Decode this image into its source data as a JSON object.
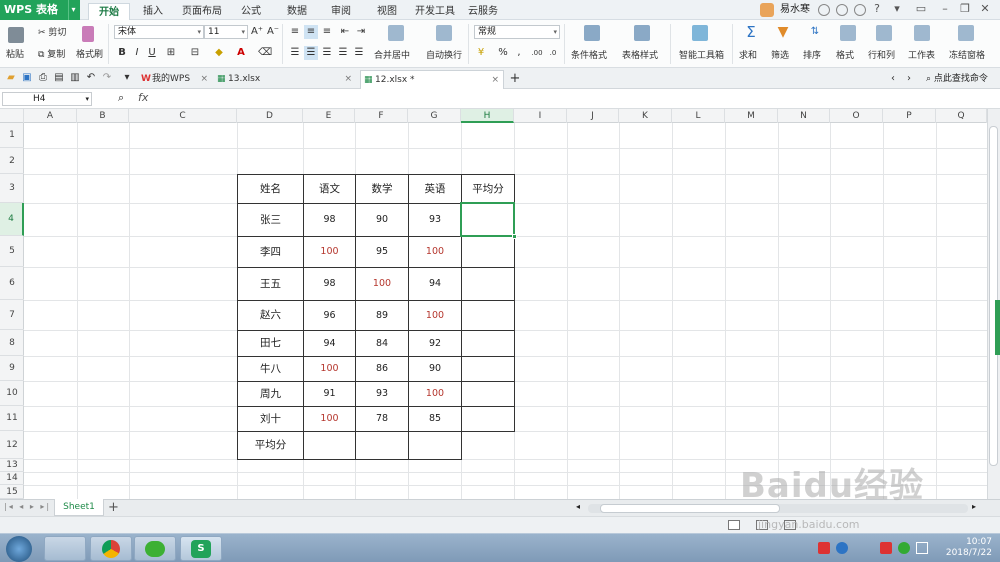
{
  "app": {
    "title": "WPS 表格",
    "brand_color": "#22a35a"
  },
  "menu": {
    "tabs": [
      "开始",
      "插入",
      "页面布局",
      "公式",
      "数据",
      "审阅",
      "视图",
      "开发工具",
      "云服务"
    ],
    "active": "开始",
    "user": "易水寒"
  },
  "ribbon": {
    "paste": "粘贴",
    "cut": "剪切",
    "copy": "复制",
    "format_painter": "格式刷",
    "font_name": "宋体",
    "font_size": "11",
    "number_format": "常规",
    "merge_center": "合并居中",
    "wrap_text": "自动换行",
    "conditional_format": "条件格式",
    "table_style": "表格样式",
    "smart_toolbox": "智能工具箱",
    "sum": "求和",
    "filter": "筛选",
    "sort": "排序",
    "format": "格式",
    "row_col": "行和列",
    "worksheet": "工作表",
    "freeze": "冻结窗格"
  },
  "doc_tabs": {
    "tabs": [
      "我的WPS",
      "13.xlsx",
      "12.xlsx *"
    ],
    "active": "12.xlsx *",
    "search_cmd": "点此查找命令"
  },
  "formula_bar": {
    "name_box": "H4",
    "fx": "fx",
    "content": ""
  },
  "columns": [
    "A",
    "B",
    "C",
    "D",
    "E",
    "F",
    "G",
    "H",
    "I",
    "J",
    "K",
    "L",
    "M",
    "N",
    "O",
    "P",
    "Q"
  ],
  "rows": [
    "1",
    "2",
    "3",
    "4",
    "5",
    "6",
    "7",
    "8",
    "9",
    "10",
    "11",
    "12",
    "13",
    "14",
    "15"
  ],
  "table": {
    "headers": [
      "姓名",
      "语文",
      "数学",
      "英语",
      "平均分"
    ],
    "rows": [
      [
        "张三",
        "98",
        "90",
        "93"
      ],
      [
        "李四",
        "100",
        "95",
        "100"
      ],
      [
        "王五",
        "98",
        "100",
        "94"
      ],
      [
        "赵六",
        "96",
        "89",
        "100"
      ],
      [
        "田七",
        "94",
        "84",
        "92"
      ],
      [
        "牛八",
        "100",
        "86",
        "90"
      ],
      [
        "周九",
        "91",
        "93",
        "100"
      ],
      [
        "刘十",
        "100",
        "78",
        "85"
      ]
    ],
    "footer": "平均分",
    "highlight_color": "#b5372e"
  },
  "sheet_tabs": {
    "tabs": [
      "Sheet1"
    ],
    "add": "+"
  },
  "taskbar": {
    "time": "10:07",
    "date": "2018/7/22"
  },
  "watermark": {
    "line1": "Baidu经验",
    "line2": "jingyan.baidu.com"
  }
}
